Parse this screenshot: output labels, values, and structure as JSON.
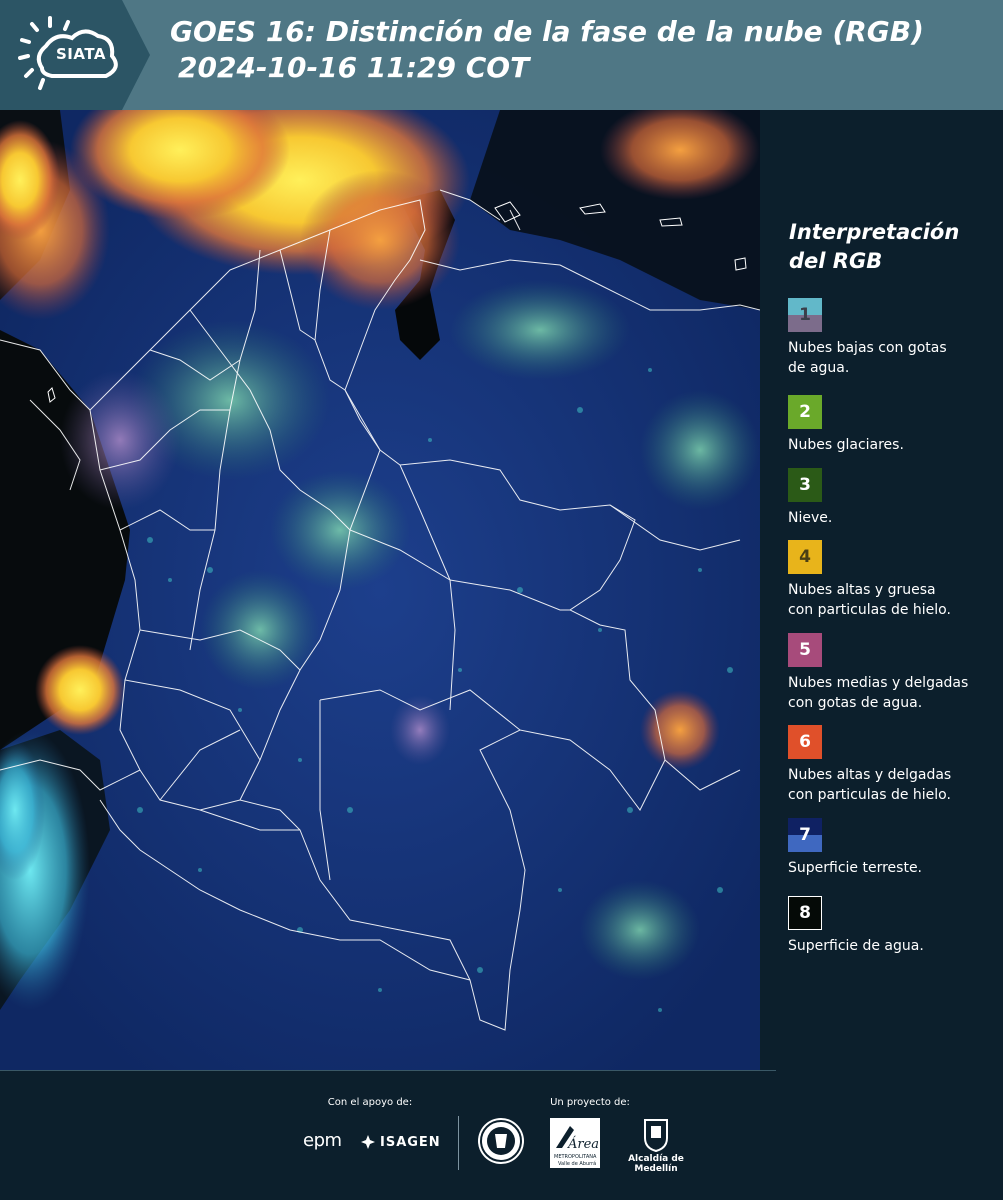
{
  "header": {
    "logo_text": "SIATA",
    "title_line1": "GOES 16: Distinción de la fase de la nube (RGB)",
    "title_line2": "2024-10-16 11:29 COT"
  },
  "legend": {
    "title_line1": "Interpretación",
    "title_line2": "del RGB",
    "items": [
      {
        "num": "1",
        "label_line1": "Nubes bajas con gotas",
        "label_line2": "de agua.",
        "color_top": "#62b8c9",
        "color_bottom": "#7c6c8b"
      },
      {
        "num": "2",
        "label_line1": "Nubes glaciares.",
        "label_line2": "",
        "color": "#6aa92a"
      },
      {
        "num": "3",
        "label_line1": "Nieve.",
        "label_line2": "",
        "color": "#2b5a17"
      },
      {
        "num": "4",
        "label_line1": "Nubes altas y gruesa",
        "label_line2": "con particulas de hielo.",
        "color": "#e8b41b"
      },
      {
        "num": "5",
        "label_line1": "Nubes medias y delgadas",
        "label_line2": "con gotas de agua.",
        "color": "#a74b7b"
      },
      {
        "num": "6",
        "label_line1": "Nubes altas y delgadas",
        "label_line2": "con particulas de hielo.",
        "color": "#e0502a"
      },
      {
        "num": "7",
        "label_line1": "Superficie terreste.",
        "label_line2": "",
        "color_top": "#0f2163",
        "color_bottom": "#3f68c0"
      },
      {
        "num": "8",
        "label_line1": "Superficie de agua.",
        "label_line2": "",
        "color": "#050a07"
      }
    ]
  },
  "footer": {
    "support_label": "Con el apoyo de:",
    "project_label": "Un proyecto de:",
    "epm": "epm",
    "isagen": "ISAGEN",
    "area_text": "Área",
    "area_sub1": "METROPOLITANA",
    "area_sub2": "Valle de Aburrá",
    "alcaldia": "Alcaldía de Medellín"
  }
}
